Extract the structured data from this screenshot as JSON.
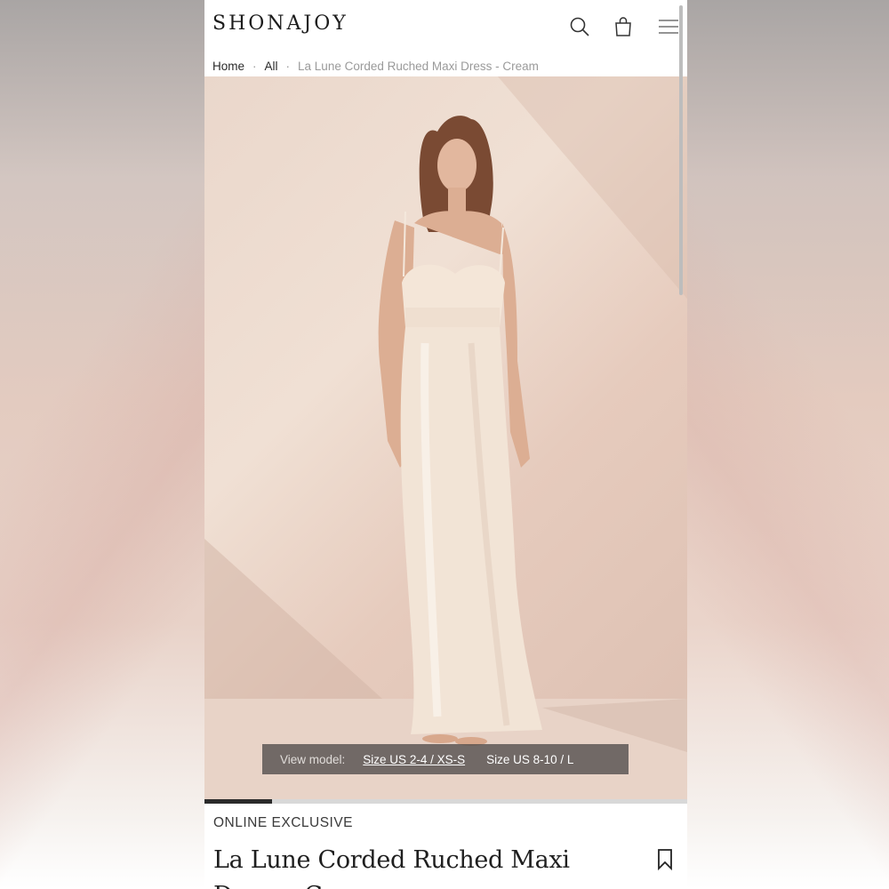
{
  "brand": {
    "logo_text": "SHONAJOY"
  },
  "header": {
    "icons": [
      "search-icon",
      "bag-icon",
      "menu-icon"
    ]
  },
  "breadcrumb": {
    "items": [
      "Home",
      "All",
      "La Lune Corded Ruched Maxi Dress - Cream"
    ],
    "separator": "·"
  },
  "gallery": {
    "view_model_label": "View model:",
    "sizes": [
      "Size US 2-4 / XS-S",
      "Size US 8-10 / L"
    ],
    "active_size_index": 0,
    "progress_fraction": 0.14
  },
  "product": {
    "badge": "ONLINE EXCLUSIVE",
    "title": "La Lune Corded Ruched Maxi Dress - Cream"
  },
  "colors": {
    "text": "#1c1c1c",
    "muted": "#9a9a9a",
    "overlay": "#504c4a",
    "progress_track": "#d8d8d8",
    "progress_fill": "#2b2b2b"
  }
}
